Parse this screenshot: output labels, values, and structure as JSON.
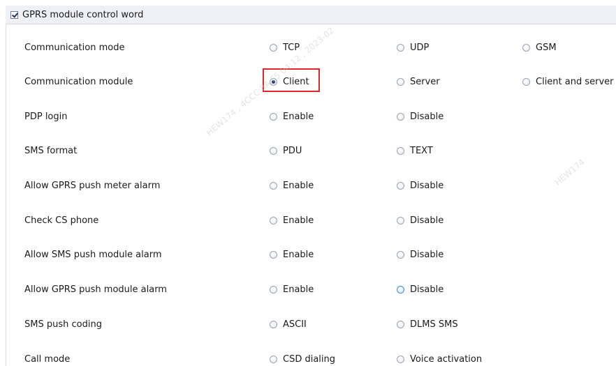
{
  "group": {
    "title": "GPRS module control word",
    "checked": true
  },
  "rows": [
    {
      "label": "Communication mode",
      "options": [
        {
          "label": "TCP",
          "selected": false
        },
        {
          "label": "UDP",
          "selected": false
        },
        {
          "label": "GSM",
          "selected": false
        }
      ]
    },
    {
      "label": "Communication module",
      "options": [
        {
          "label": "Client",
          "selected": true
        },
        {
          "label": "Server",
          "selected": false
        },
        {
          "label": "Client and server",
          "selected": false
        }
      ]
    },
    {
      "label": "PDP login",
      "options": [
        {
          "label": "Enable",
          "selected": false
        },
        {
          "label": "Disable",
          "selected": false
        }
      ]
    },
    {
      "label": "SMS format",
      "options": [
        {
          "label": "PDU",
          "selected": false
        },
        {
          "label": "TEXT",
          "selected": false
        }
      ]
    },
    {
      "label": "Allow GPRS push meter alarm",
      "options": [
        {
          "label": "Enable",
          "selected": false
        },
        {
          "label": "Disable",
          "selected": false
        }
      ]
    },
    {
      "label": "Check CS phone",
      "options": [
        {
          "label": "Enable",
          "selected": false
        },
        {
          "label": "Disable",
          "selected": false
        }
      ]
    },
    {
      "label": "Allow SMS push module alarm",
      "options": [
        {
          "label": "Enable",
          "selected": false
        },
        {
          "label": "Disable",
          "selected": false
        }
      ]
    },
    {
      "label": "Allow GPRS push module alarm",
      "options": [
        {
          "label": "Enable",
          "selected": false
        },
        {
          "label": "Disable",
          "selected": false,
          "hover": true
        }
      ]
    },
    {
      "label": "SMS push coding",
      "options": [
        {
          "label": "ASCII",
          "selected": false
        },
        {
          "label": "DLMS SMS",
          "selected": false
        }
      ]
    },
    {
      "label": "Call mode",
      "options": [
        {
          "label": "CSD dialing",
          "selected": false
        },
        {
          "label": "Voice activation",
          "selected": false
        }
      ]
    }
  ],
  "watermark": {
    "text_1": "HEW174 , 4CCC:8A:F5 04:12 , 2023-02",
    "text_2": "HEW174"
  },
  "colors": {
    "highlight": "#e0262a",
    "header_bg": "#eef0f3",
    "radio_hover": "#3a8ee6"
  }
}
